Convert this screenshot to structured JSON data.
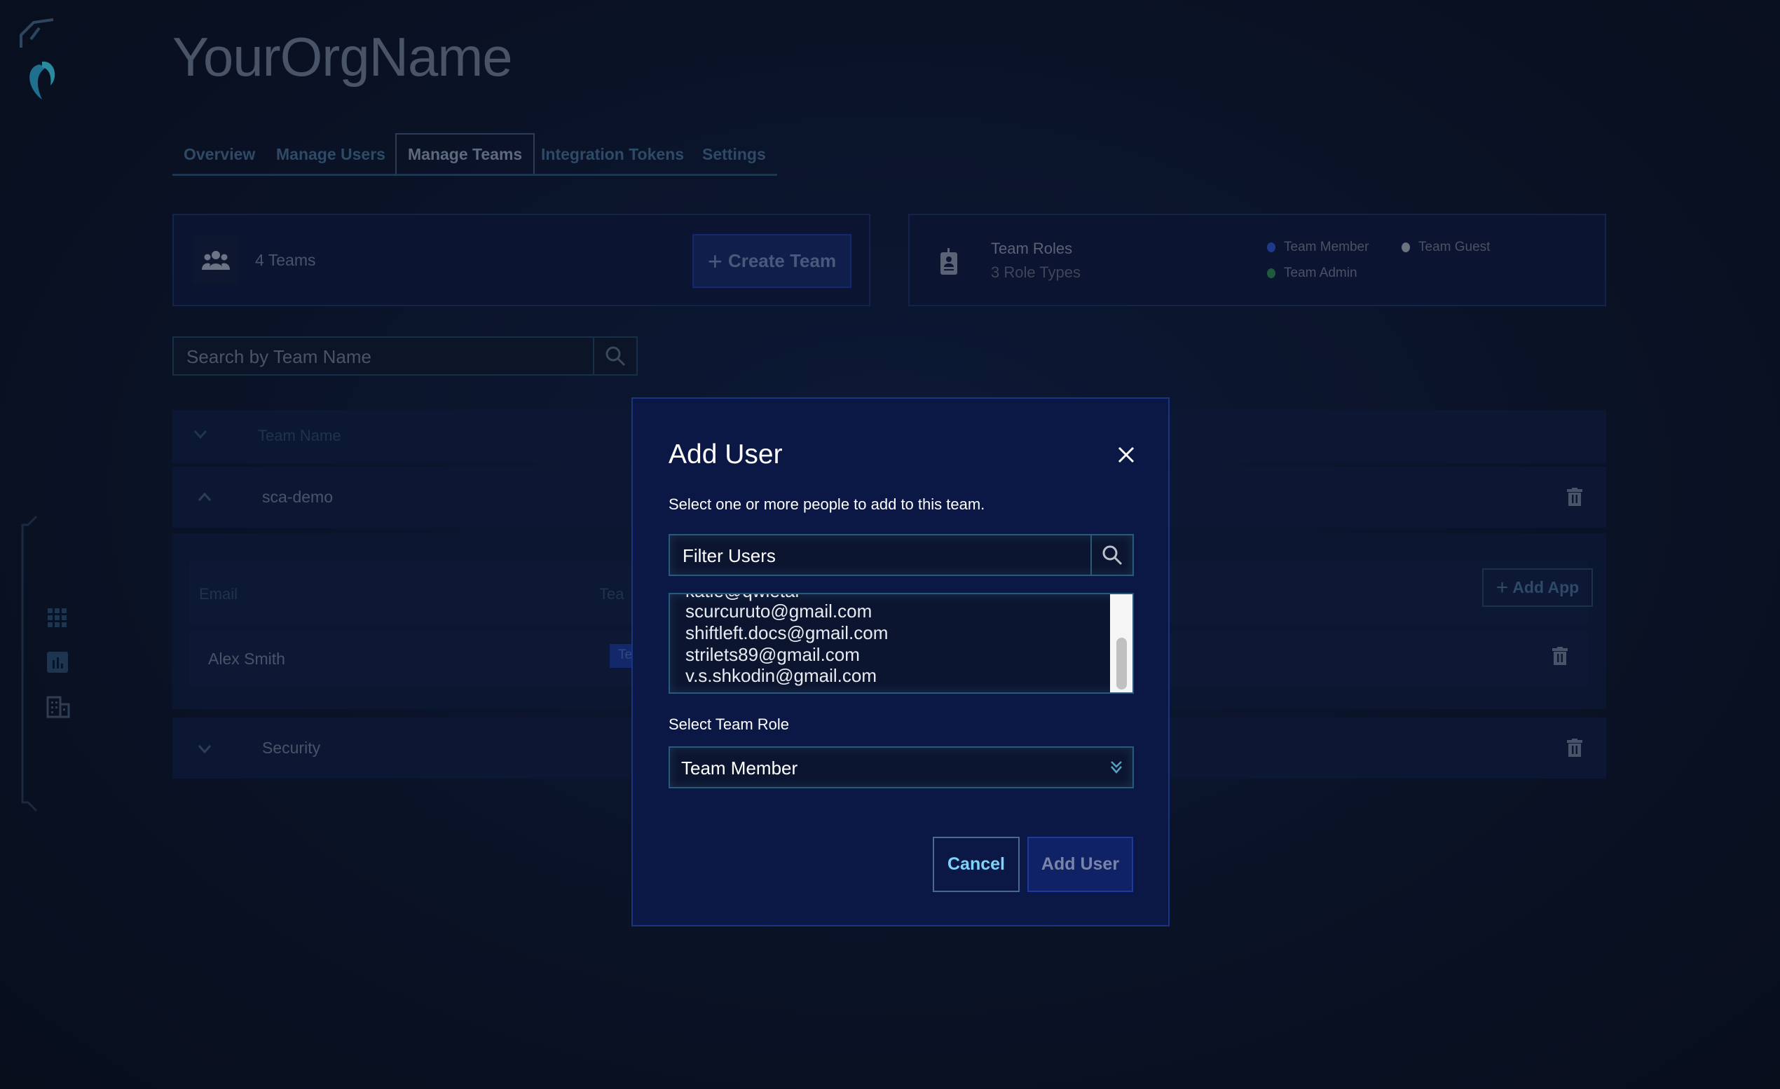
{
  "org_name": "YourOrgName",
  "tabs": [
    {
      "label": "Overview"
    },
    {
      "label": "Manage Users"
    },
    {
      "label": "Manage Teams",
      "active": true
    },
    {
      "label": "Integration Tokens"
    },
    {
      "label": "Settings"
    }
  ],
  "teams_card": {
    "count_label": "4 Teams",
    "create_button": "Create Team"
  },
  "roles_card": {
    "title": "Team Roles",
    "subtitle": "3 Role Types",
    "legend": [
      {
        "label": "Team Member",
        "color": "#1f3a8a"
      },
      {
        "label": "Team Guest",
        "color": "#6b7280"
      },
      {
        "label": "Team Admin",
        "color": "#1f5a3a"
      }
    ]
  },
  "search": {
    "placeholder": "Search by Team Name"
  },
  "table": {
    "header": "Team Name",
    "teams": [
      {
        "name": "sca-demo",
        "expanded": true
      },
      {
        "name": "Security",
        "expanded": false
      }
    ],
    "members": {
      "email_header": "Email",
      "team_header": "Tea",
      "rows": [
        {
          "name": "Alex Smith",
          "badge": "Te"
        }
      ]
    },
    "add_app": "Add App"
  },
  "modal": {
    "title": "Add User",
    "description": "Select one or more people to add to this team.",
    "filter_placeholder": "Filter Users",
    "users": [
      "katie@qwietai",
      "scurcuruto@gmail.com",
      "shiftleft.docs@gmail.com",
      "strilets89@gmail.com",
      "v.s.shkodin@gmail.com"
    ],
    "role_label": "Select Team Role",
    "role_value": "Team Member",
    "cancel": "Cancel",
    "submit": "Add User"
  },
  "colors": {
    "accent": "#7dd3fc",
    "modal_bg": "#0b1846"
  }
}
